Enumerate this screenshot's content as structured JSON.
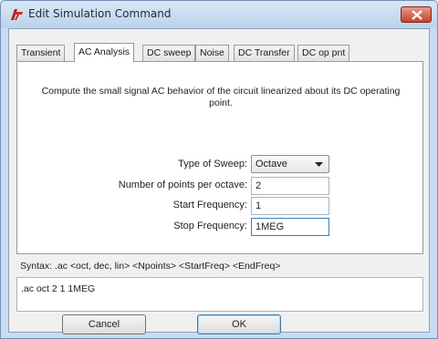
{
  "window": {
    "title": "Edit Simulation Command",
    "app_icon": "ltspice-logo-icon",
    "close_icon": "close-icon"
  },
  "tabs": [
    {
      "label": "Transient"
    },
    {
      "label": "AC Analysis",
      "active": true
    },
    {
      "label": "DC sweep"
    },
    {
      "label": "Noise"
    },
    {
      "label": "DC Transfer"
    },
    {
      "label": "DC op pnt"
    }
  ],
  "ac_analysis": {
    "description": "Compute the small signal AC behavior of the circuit linearized about its DC operating point.",
    "sweep_type": {
      "label": "Type of Sweep:",
      "value": "Octave"
    },
    "points": {
      "label": "Number of points per octave:",
      "value": "2"
    },
    "start_freq": {
      "label": "Start Frequency:",
      "value": "1"
    },
    "stop_freq": {
      "label": "Stop Frequency:",
      "value": "1MEG"
    }
  },
  "syntax": "Syntax: .ac <oct, dec, lin> <Npoints> <StartFreq> <EndFreq>",
  "command_text": ".ac oct 2 1 1MEG",
  "buttons": {
    "cancel": "Cancel",
    "ok": "OK"
  },
  "colors": {
    "title_bar": "#c9dcef",
    "close_button": "#c8422c",
    "focus_border": "#3c7fb1"
  }
}
